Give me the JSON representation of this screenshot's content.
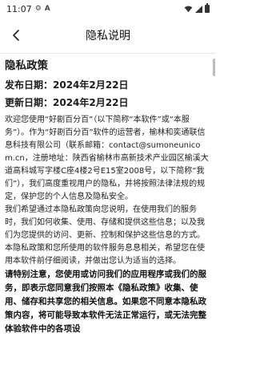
{
  "status_bar": {
    "time": "11:07",
    "icons": [
      "gear-icon",
      "a-icon",
      "wifi-icon",
      "signal-icon",
      "battery-icon"
    ]
  },
  "app_bar": {
    "title": "隐私说明",
    "back_icon": "chevron-left-icon"
  },
  "document": {
    "heading": "隐私政策",
    "published_label": "发布日期：2024年2月22日",
    "updated_label": "更新日期：2024年2月22日",
    "paragraph1": "欢迎您使用“好剧百分百”（以下简称“本软件”或“本服务”）。作为“好剧百分百”软件的运营者，榆林和奕通联信息科技有限公司（联系邮箱：contact@sumoneunicom.cn，注册地址：陕西省榆林市高新技术产业园区榆溪大道高科城写字楼C座4楼2号E15室2008号，以下简称“我们”），我们高度重视用户的隐私，并将按照法律法规的规定，保护您的个人信息及隐私安全。",
    "paragraph2": "我们希望通过本隐私政策向您说明，在使用我们的服务时，我们如何收集、使用、存储和提供这些信息；以及我们为您提供的访问、更新、控制和保护这些信息的方式。本隐私政策和您所使用的软件服务息息相关，希望您在使用本软件前仔细阅读，并做出您认为适当的选择。",
    "paragraph3": "请特别注意，您使用或访问我们的应用程序或我们的服务，即表示您同意我们按照本《隐私政策》收集、使用、储存和共享您的相关信息。如果您不同意本隐私政策内容，将可能导致本软件无法正常运行，或无法完整体验软件中的各项设"
  },
  "colors": {
    "background": "#ffffff",
    "text": "#1a1a1a",
    "divider": "#e6e6e6"
  }
}
